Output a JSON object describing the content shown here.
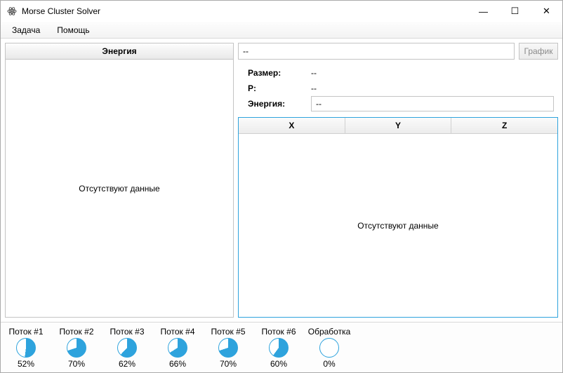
{
  "window": {
    "title": "Morse Cluster Solver",
    "controls": {
      "min": "—",
      "max": "☐",
      "close": "✕"
    }
  },
  "menu": {
    "task": "Задача",
    "help": "Помощь"
  },
  "left": {
    "header": "Энергия",
    "empty": "Отсутствуют данные"
  },
  "right": {
    "input_value": "--",
    "graph_btn": "График",
    "props": {
      "size_label": "Размер:",
      "size_value": "--",
      "p_label": "P:",
      "p_value": "--",
      "energy_label": "Энергия:",
      "energy_value": "--"
    },
    "table": {
      "x": "X",
      "y": "Y",
      "z": "Z",
      "empty": "Отсутствуют данные"
    }
  },
  "threads": [
    {
      "label": "Поток #1",
      "pct": "52%",
      "val": 52
    },
    {
      "label": "Поток #2",
      "pct": "70%",
      "val": 70
    },
    {
      "label": "Поток #3",
      "pct": "62%",
      "val": 62
    },
    {
      "label": "Поток #4",
      "pct": "66%",
      "val": 66
    },
    {
      "label": "Поток #5",
      "pct": "70%",
      "val": 70
    },
    {
      "label": "Поток #6",
      "pct": "60%",
      "val": 60
    },
    {
      "label": "Обработка",
      "pct": "0%",
      "val": 0
    }
  ],
  "colors": {
    "accent": "#2ea3dd"
  }
}
